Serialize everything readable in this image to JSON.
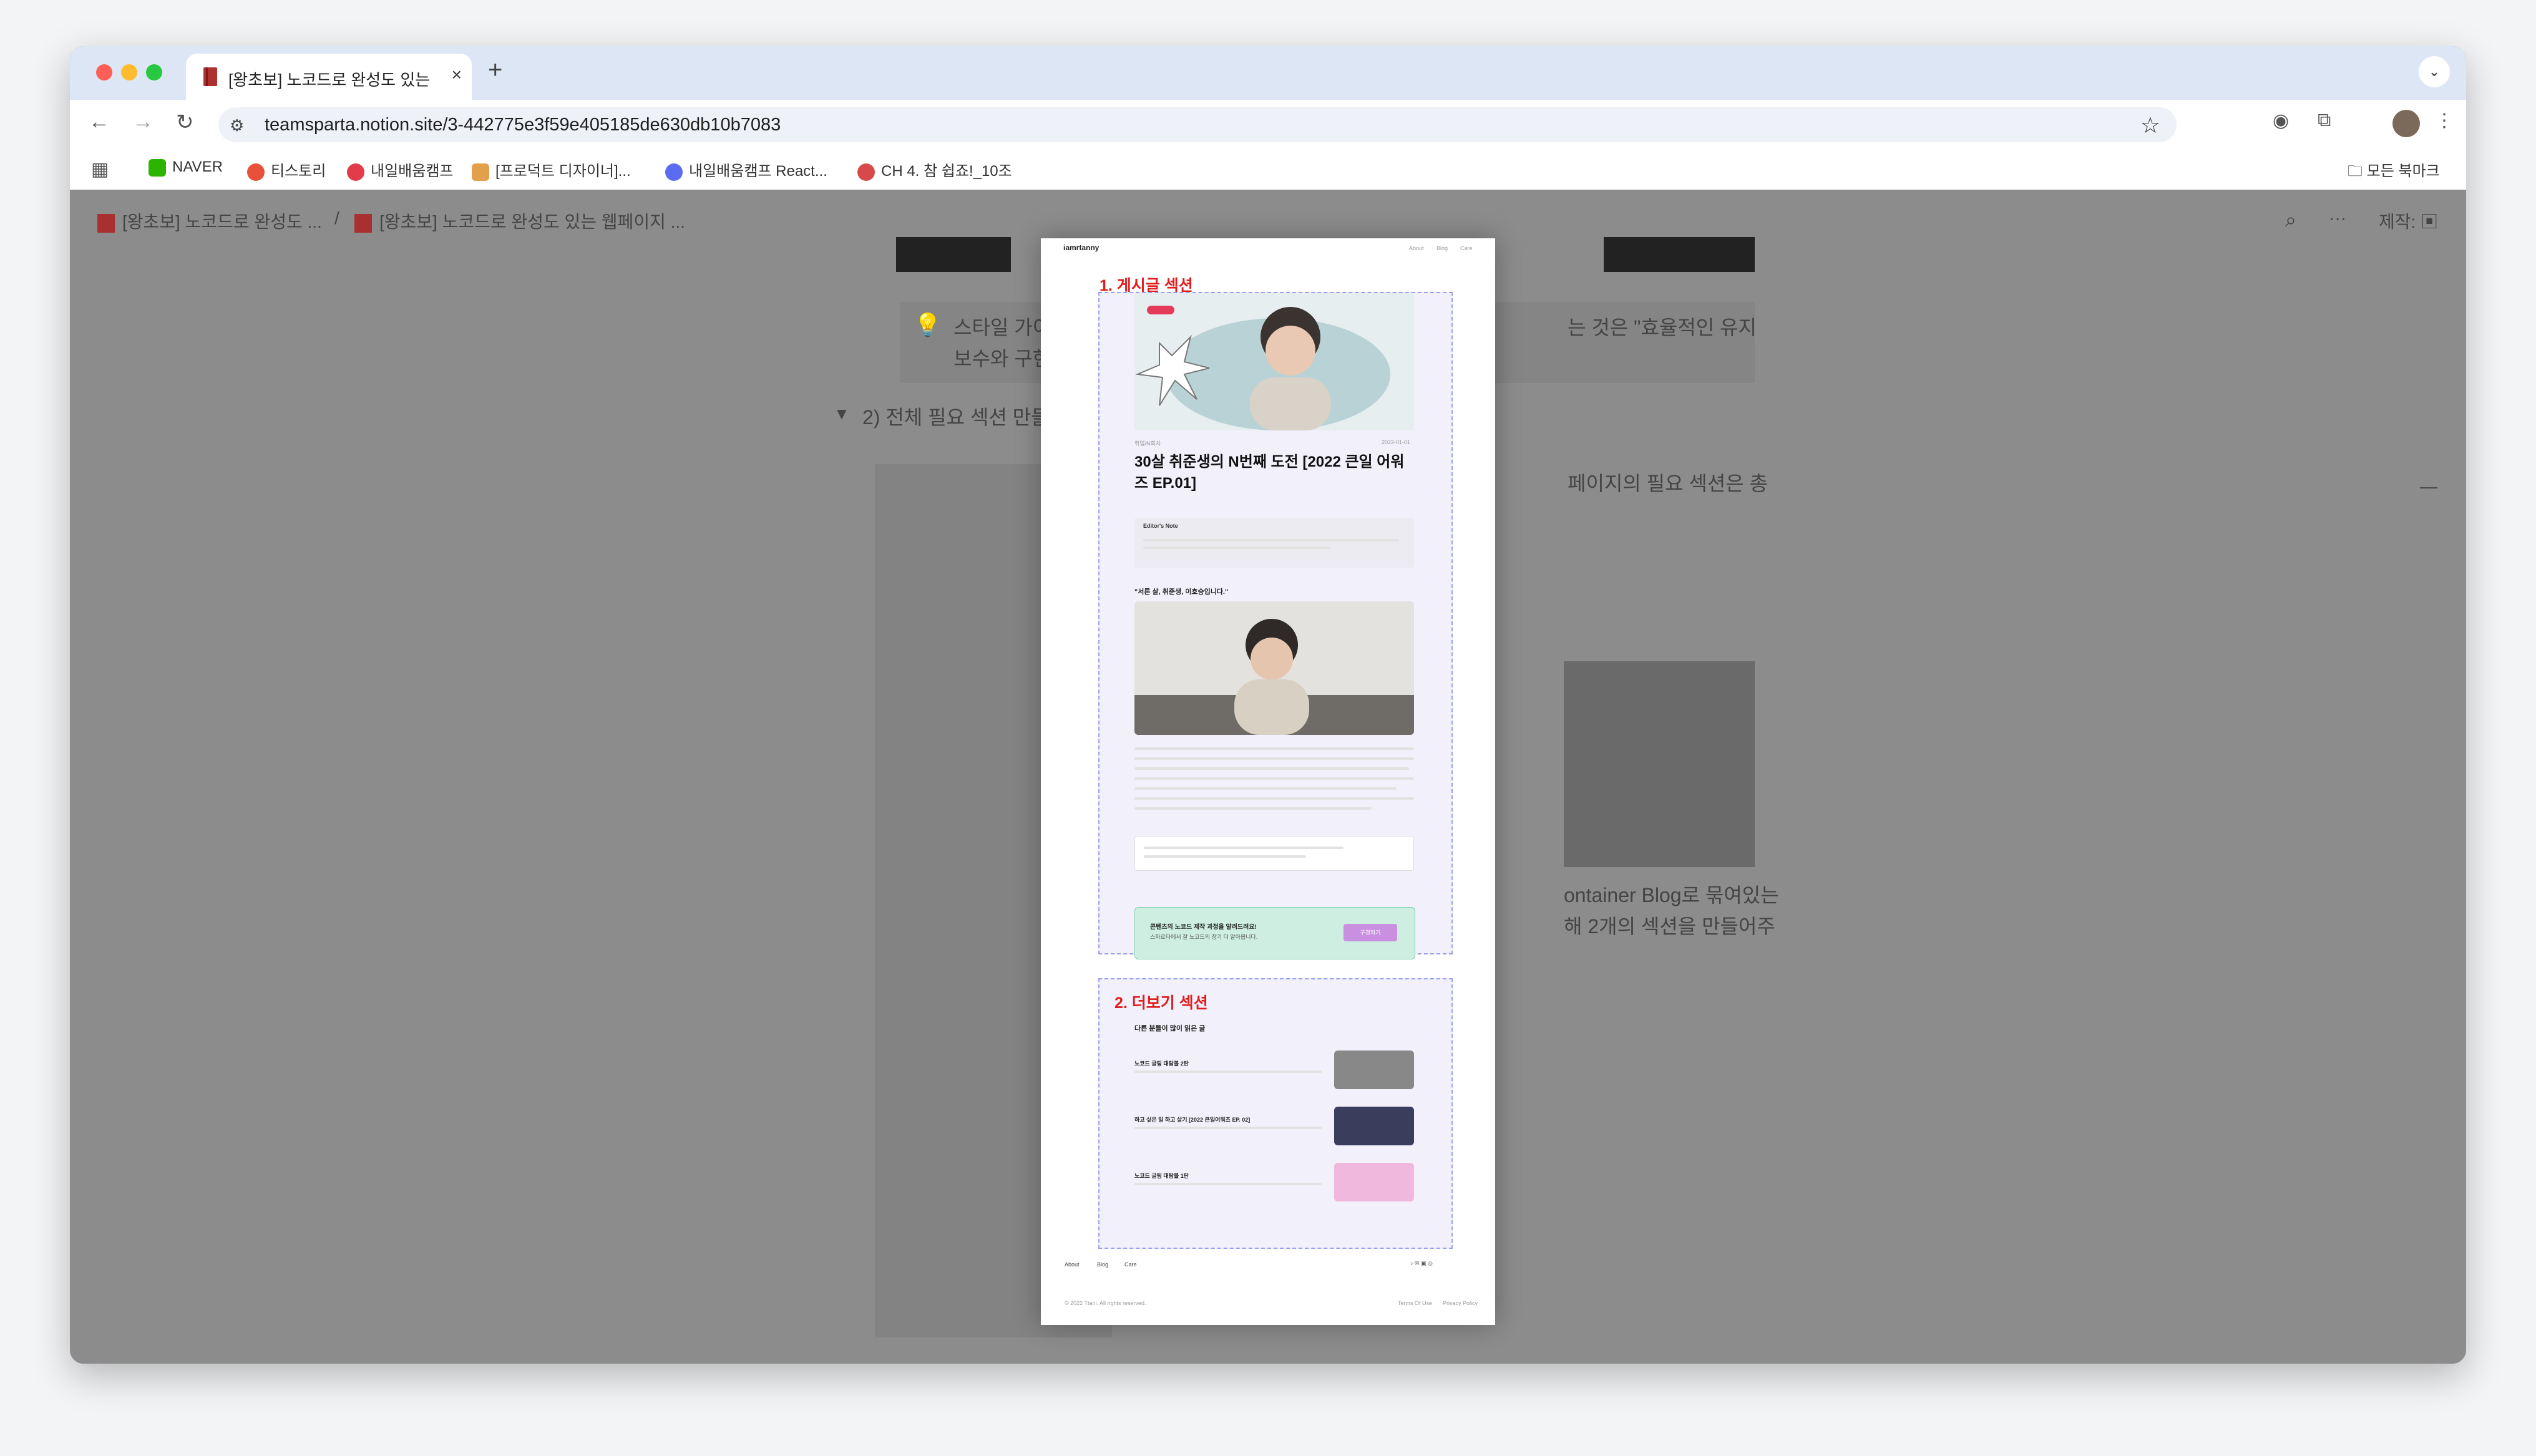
{
  "browser": {
    "tab_title": "[왕초보] 노코드로 완성도 있는 웹페이지",
    "tab_close": "×",
    "new_tab": "+",
    "tabs_menu": "⌄",
    "url": "teamsparta.notion.site/3-442775e3f59e405185de630db10b7083",
    "bookmarks": [
      "NAVER",
      "티스토리",
      "내일배움캠프",
      "[프로덕트 디자이너]...",
      "내일배움캠프 React...",
      "CH 4. 참 쉽죠!_10조"
    ],
    "all_bookmarks": "모든 북마크"
  },
  "notion": {
    "breadcrumb": [
      "[왕초보] 노코드로 완성도 ...",
      "[왕초보] 노코드로 완성도 있는 웹페이지 ..."
    ],
    "separator": "/",
    "made_with": "제작:",
    "callout_left": "스타일 가이",
    "callout_left2": "보수와 구현",
    "callout_right": "는 것은 \"효율적인 유지",
    "toggle_heading": "2) 전체 필요 섹션 만들",
    "right_text1": "페이지의 필요 섹션은 총",
    "right_text2": "ontainer Blog로 묶여있는",
    "right_text3": "해 2개의 섹션을 만들어주"
  },
  "preview": {
    "logo": "iamrtanny",
    "nav": [
      "About",
      "Blog",
      "Care"
    ],
    "section1_label": "1. 게시글 섹션",
    "section2_label": "2. 더보기 섹션",
    "post_meta_left": "취업/N회차",
    "post_date": "2022-01-01",
    "post_title": "30살 취준생의 N번째 도전 [2022 큰일 어워즈 EP.01]",
    "editors_note": "Editor's Note",
    "quote": "\"서른 살, 취준생, 이호승입니다.\"",
    "cta_title": "콘텐츠의 노코드 제작 과정을 알려드려요!",
    "cta_sub": "스파르타에서 잘 노코드의 장기 더 알아봅니다.",
    "cta_button": "구경하기",
    "more_heading": "다른 분들이 많이 읽은 글",
    "more_items": [
      {
        "title": "노코드 글링 대탐볼 2탄"
      },
      {
        "title": "하고 싶은 일 하고 살기 [2022 큰일어워즈 EP. 02]"
      },
      {
        "title": "노코드 글링 대탐볼 1탄"
      }
    ],
    "footer_nav": [
      "About",
      "Blog",
      "Care"
    ],
    "footer_copy": "© 2022 Ttani. All rights reserved.",
    "footer_links": [
      "Terms Of Use",
      "Privacy Policy"
    ]
  },
  "colors": {
    "section_bg": "#f2f0fb",
    "section_border": "#9aa0f0",
    "accent_red": "#e01e1e",
    "cta_bg": "#cdeee0"
  }
}
